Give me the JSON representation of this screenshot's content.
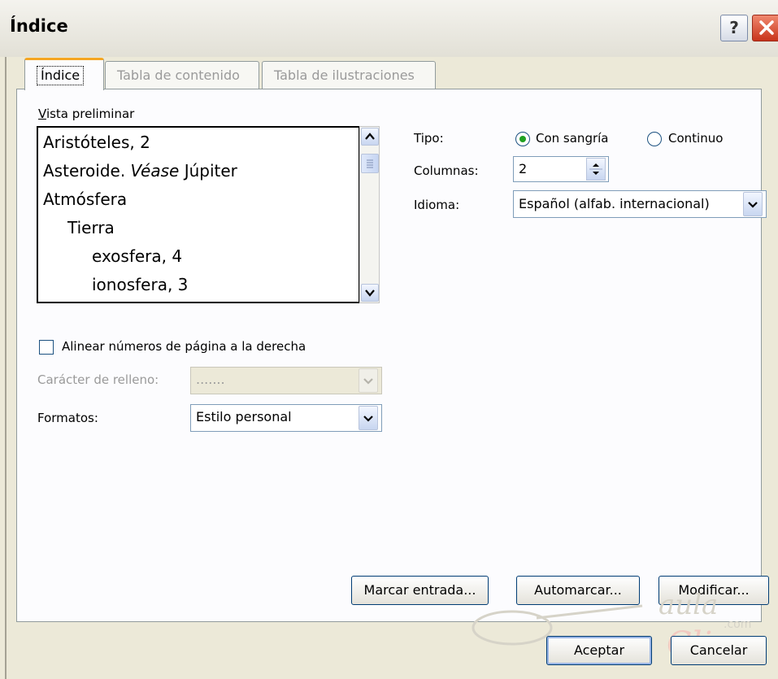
{
  "window": {
    "title": "Índice",
    "help_label": "?"
  },
  "tabs": [
    {
      "label": "Índice",
      "active": true
    },
    {
      "label": "Tabla de contenido",
      "active": false
    },
    {
      "label": "Tabla de ilustraciones",
      "active": false
    }
  ],
  "preview": {
    "label": "Vista preliminar",
    "lines": [
      {
        "text": "Aristóteles, 2"
      },
      {
        "text_normal": "Asteroide. ",
        "text_italic": "Véase",
        "text_after": " Júpiter"
      },
      {
        "text": "Atmósfera"
      },
      {
        "text": "Tierra"
      },
      {
        "text": "exosfera, 4"
      },
      {
        "text": "ionosfera, 3"
      }
    ]
  },
  "tipo": {
    "label": "Tipo:",
    "options": [
      "Con sangría",
      "Continuo"
    ],
    "selected": "Con sangría"
  },
  "columnas": {
    "label": "Columnas:",
    "value": "2"
  },
  "idioma": {
    "label": "Idioma:",
    "value": "Español (alfab. internacional)"
  },
  "alinear": {
    "label": "Alinear números de página a la derecha",
    "checked": false
  },
  "relleno": {
    "label": "Carácter de relleno:",
    "value": "......."
  },
  "formatos": {
    "label": "Formatos:",
    "value": "Estilo personal"
  },
  "buttons": {
    "marcar": "Marcar entrada...",
    "automarcar": "Automarcar...",
    "modificar": "Modificar...",
    "aceptar": "Aceptar",
    "cancelar": "Cancelar"
  },
  "watermark": "aula Clic .com"
}
